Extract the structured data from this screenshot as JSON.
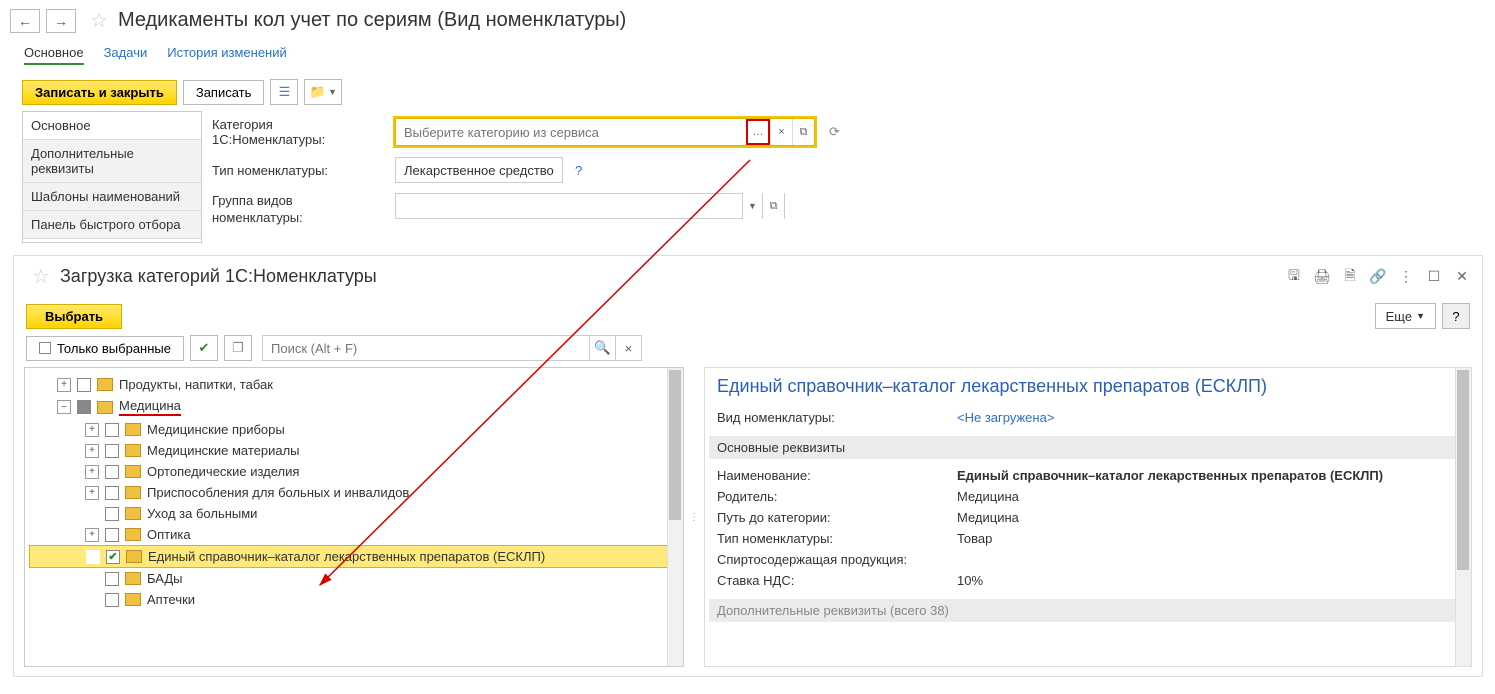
{
  "header": {
    "title": "Медикаменты кол учет по сериям (Вид номенклатуры)"
  },
  "tabs": {
    "main": "Основное",
    "tasks": "Задачи",
    "history": "История изменений"
  },
  "toolbar": {
    "save_close": "Записать и закрыть",
    "save": "Записать"
  },
  "sidebar": {
    "items": [
      "Основное",
      "Дополнительные реквизиты",
      "Шаблоны наименований",
      "Панель быстрого отбора"
    ]
  },
  "fields": {
    "category_label": "Категория 1С:Номенклатуры:",
    "category_placeholder": "Выберите категорию из сервиса",
    "type_label": "Тип номенклатуры:",
    "type_value": "Лекарственное средство",
    "group_label": "Группа видов номенклатуры:"
  },
  "modal": {
    "title": "Загрузка категорий 1С:Номенклатуры",
    "select": "Выбрать",
    "only_selected": "Только выбранные",
    "search_placeholder": "Поиск (Alt + F)",
    "more": "Еще",
    "tree": {
      "n0": "Продукты, напитки, табак",
      "n1": "Медицина",
      "n2": "Медицинские приборы",
      "n3": "Медицинские материалы",
      "n4": "Ортопедические изделия",
      "n5": "Приспособления для больных и инвалидов",
      "n6": "Уход за больными",
      "n7": "Оптика",
      "n8": "Единый справочник–каталог лекарственных препаратов (ЕСКЛП)",
      "n9": "БАДы",
      "n10": "Аптечки"
    },
    "detail": {
      "title": "Единый справочник–каталог лекарственных препаратов (ЕСКЛП)",
      "kind_label": "Вид номенклатуры:",
      "kind_value": "<Не загружена>",
      "section1": "Основные реквизиты",
      "name_label": "Наименование:",
      "name_value": "Единый справочник–каталог лекарственных препаратов (ЕСКЛП)",
      "parent_label": "Родитель:",
      "parent_value": "Медицина",
      "path_label": "Путь до категории:",
      "path_value": "Медицина",
      "type_label": "Тип номенклатуры:",
      "type_value": "Товар",
      "alcohol_label": "Спиртосодержащая продукция:",
      "vat_label": "Ставка НДС:",
      "vat_value": "10%",
      "section2": "Дополнительные реквизиты (всего 38)"
    }
  }
}
